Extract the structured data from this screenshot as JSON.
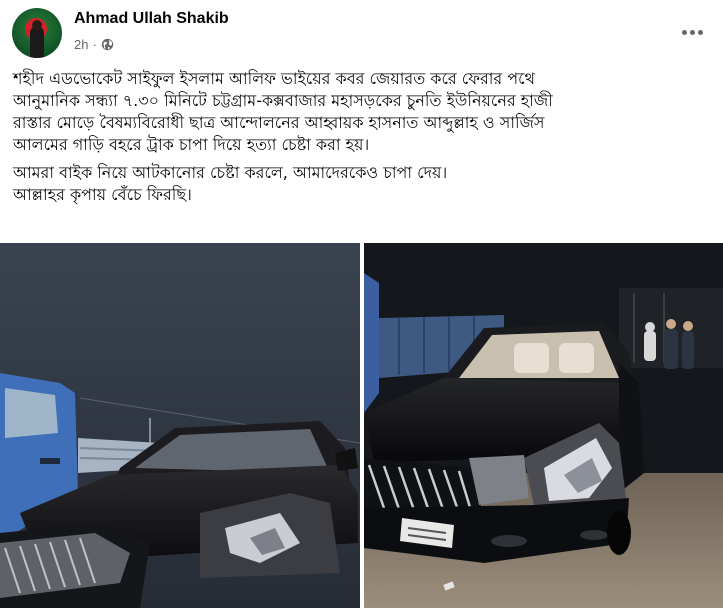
{
  "post": {
    "author": "Ahmad Ullah Shakib",
    "time": "2h",
    "separator": "·",
    "privacy_icon": "globe-icon",
    "menu_icon": "more-options-icon",
    "paragraphs": [
      {
        "lines": [
          "শহীদ এডভোকেট সাইফুল ইসলাম আলিফ ভাইয়ের কবর জেয়ারত করে ফেরার পথে",
          "আনুমানিক সন্ধ্যা ৭.৩০ মিনিটে চট্টগ্রাম-কক্সবাজার মহাসড়কের চুনতি ইউনিয়নের হাজী",
          "রাস্তার মোড়ে বৈষম্যবিরোধী ছাত্র আন্দোলনের আহ্বায়ক হাসনাত আব্দুল্লাহ ও সার্জিস",
          "আলমের গাড়ি বহরে ট্রাক চাপা দিয়ে হত্যা চেষ্টা করা হয়।"
        ]
      },
      {
        "lines": [
          "আমরা বাইক নিয়ে আটকানোর চেষ্টা করলে, আমাদেরকেও চাপা দেয়।",
          "আল্লাহর কৃপায় বেঁচে ফিরছি।"
        ]
      }
    ],
    "photos": [
      {
        "name": "damaged-car-photo-left"
      },
      {
        "name": "damaged-car-photo-right"
      }
    ]
  },
  "colors": {
    "text": "#050505",
    "secondary_text": "#65676b",
    "background": "#ffffff"
  }
}
